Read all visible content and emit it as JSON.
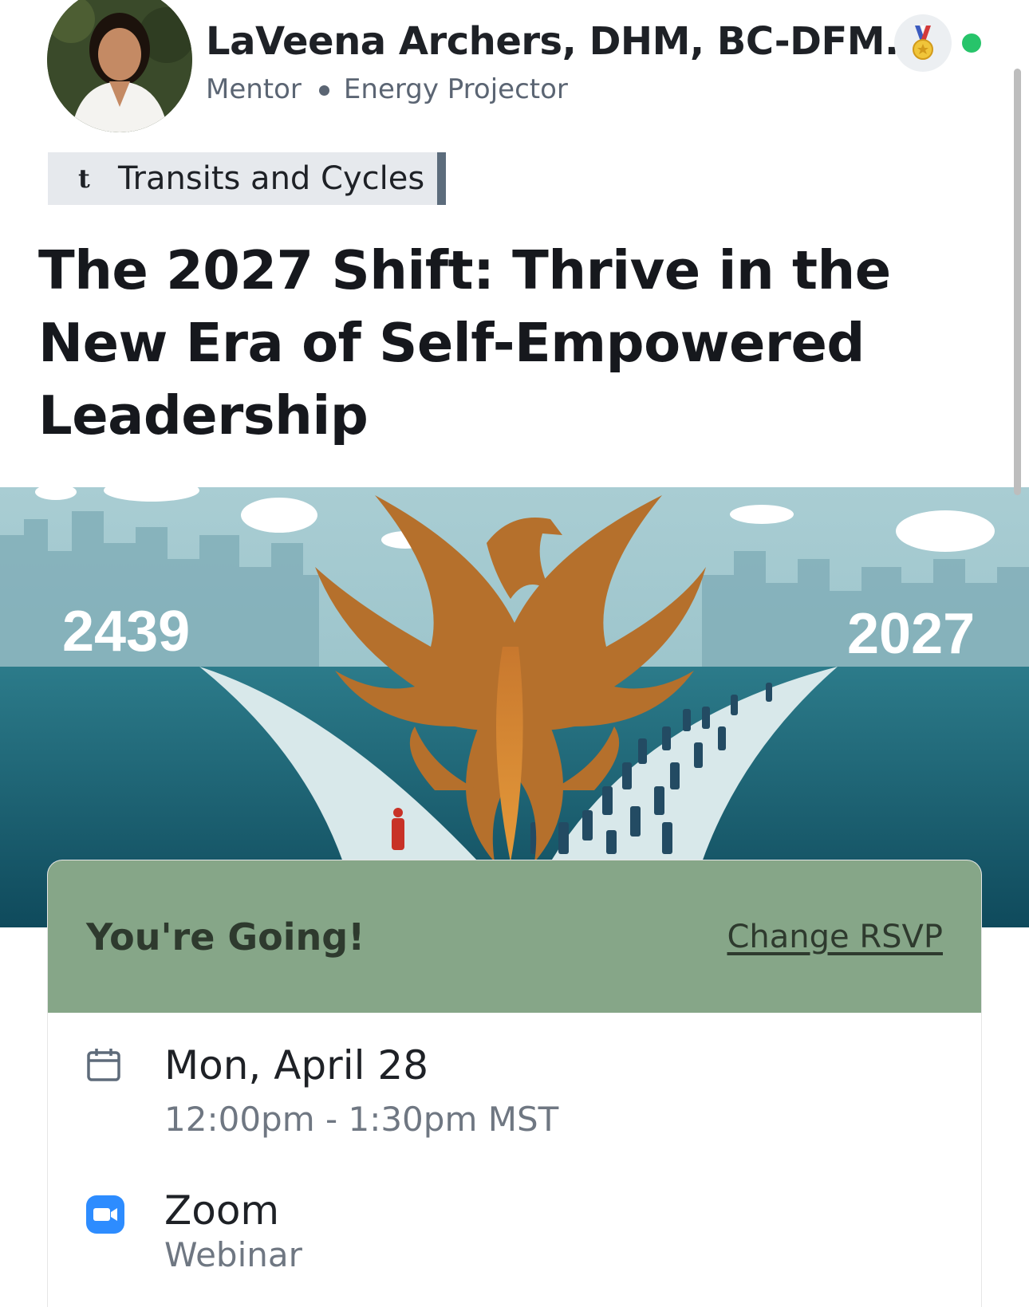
{
  "author": {
    "name": "LaVeena Archers, DHM, BC-DFM...",
    "role": "Mentor",
    "title": "Energy Projector"
  },
  "tag": {
    "icon": "t",
    "label": "Transits and Cycles"
  },
  "event": {
    "title": "The 2027 Shift: Thrive in the New Era of Self-Empowered Leadership"
  },
  "banner": {
    "year_left": "2439",
    "year_right": "2027"
  },
  "rsvp": {
    "status": "You're Going!",
    "change_label": "Change RSVP"
  },
  "details": {
    "date": "Mon, April 28",
    "time": "12:00pm - 1:30pm MST",
    "platform": "Zoom",
    "platform_type": "Webinar"
  },
  "colors": {
    "rsvp_bg": "#86a688",
    "online": "#27c46a",
    "zoom": "#2d8cff",
    "phoenix": "#b5702c"
  }
}
